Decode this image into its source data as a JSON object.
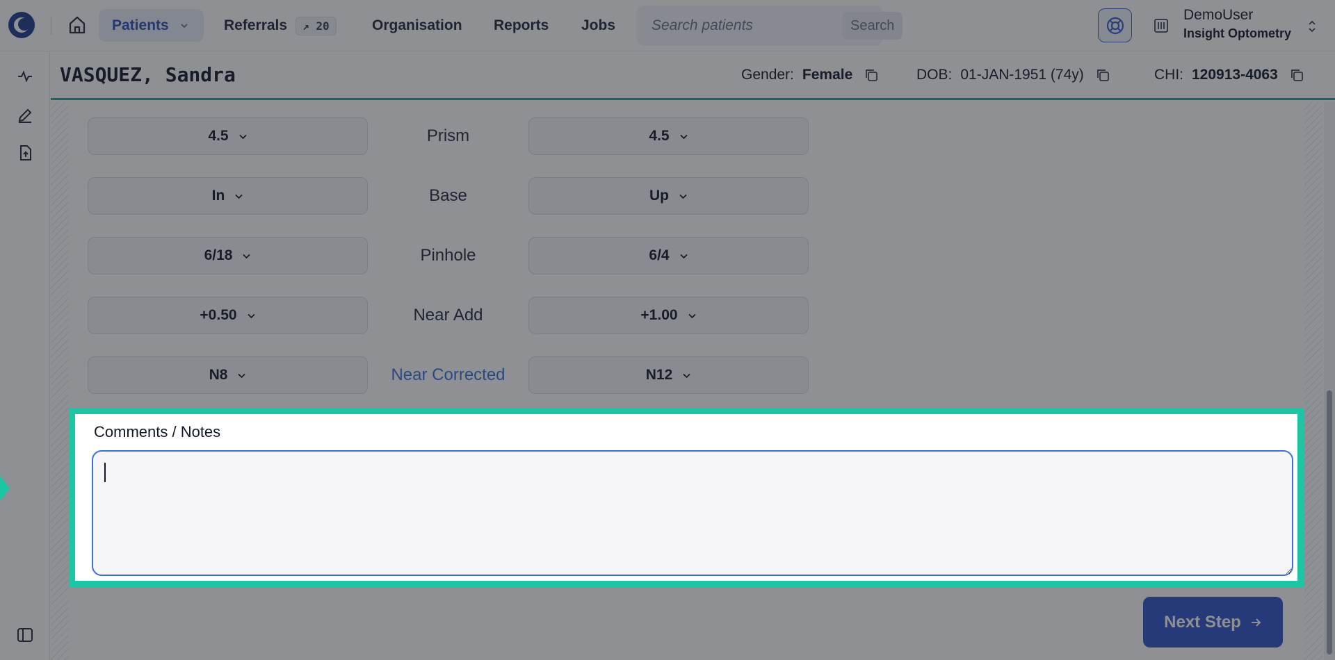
{
  "nav": {
    "patients_label": "Patients",
    "referrals_label": "Referrals",
    "referrals_badge": "↗ 20",
    "organisation_label": "Organisation",
    "reports_label": "Reports",
    "jobs_label": "Jobs",
    "search_placeholder": "Search patients",
    "search_button": "Search",
    "user_name": "DemoUser",
    "user_org": "Insight Optometry"
  },
  "patient": {
    "name": "VASQUEZ, Sandra",
    "gender_label": "Gender:",
    "gender": "Female",
    "dob_label": "DOB:",
    "dob": "01-JAN-1951 (74y)",
    "chi_label": "CHI:",
    "chi": "120913-4063"
  },
  "rows": [
    {
      "label": "Prism",
      "left": "4.5",
      "right": "4.5"
    },
    {
      "label": "Base",
      "left": "In",
      "right": "Up"
    },
    {
      "label": "Pinhole",
      "left": "6/18",
      "right": "6/4"
    },
    {
      "label": "Near Add",
      "left": "+0.50",
      "right": "+1.00"
    },
    {
      "label": "Near Corrected",
      "left": "N8",
      "right": "N12"
    }
  ],
  "notes": {
    "label": "Comments / Notes",
    "value": ""
  },
  "next_button": "Next Step",
  "colors": {
    "accent": "#2f51c9",
    "highlight": "#1cc5a4",
    "patient_bar_border": "#1aa88f"
  }
}
